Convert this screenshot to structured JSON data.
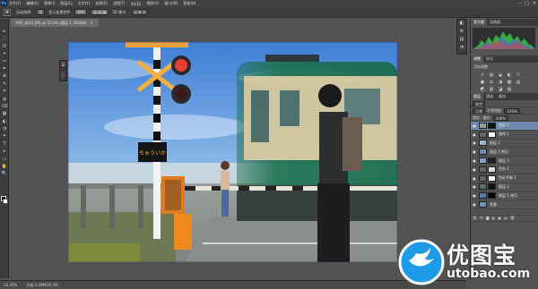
{
  "app": {
    "logo": "Ps",
    "window_controls": [
      "–",
      "□",
      "✕"
    ]
  },
  "menu": [
    "文件(F)",
    "编辑(E)",
    "图像(I)",
    "图层(L)",
    "文字(Y)",
    "选择(S)",
    "滤镜(T)",
    "3D(D)",
    "视图(V)",
    "窗口(W)",
    "帮助(H)"
  ],
  "options": {
    "tool_icon": "move-tool-icon",
    "items": [
      "自动选择:",
      "组",
      "显示变换控件"
    ],
    "align_label": "对齐",
    "mode_label": "3D 模式:"
  },
  "document": {
    "tab_title": "IMG_0021.JPG @ 33.3% (图层 1, RGB/8)",
    "close": "×"
  },
  "collapsed_panel": [
    "☰",
    "ⓘ"
  ],
  "tools": [
    "▸",
    "⬚",
    "ʘ",
    "⌖",
    "✂",
    "✒",
    "⊕",
    "✎",
    "⌗",
    "◍",
    "⌫",
    "▦",
    "◐",
    "◔",
    "✦",
    "T",
    "▸",
    "▭",
    "✋",
    "🔍"
  ],
  "right_strip": [
    "◧",
    "⚙",
    "▤",
    "◔"
  ],
  "histogram_tabs": [
    "直方图",
    "导航器"
  ],
  "adjust_panel": {
    "tabs": [
      "调整",
      "样式"
    ],
    "title": "添加调整",
    "row1": [
      "☼",
      "▥",
      "◒",
      "◐",
      "▽"
    ],
    "row2": [
      "▣",
      "⚖",
      "◑",
      "▦",
      "▤"
    ],
    "row3": [
      "◩",
      "▨",
      "◪",
      "▧"
    ]
  },
  "layers_panel": {
    "tabs": [
      "图层",
      "通道",
      "路径"
    ],
    "kind_label": "类型",
    "blend_mode": "正常",
    "opacity_label": "不透明度:",
    "opacity": "100%",
    "lock_label": "锁定:",
    "fill_label": "填充:",
    "fill": "100%",
    "layers": [
      {
        "name": "图层 4",
        "selected": true,
        "mask": true
      },
      {
        "name": "曲线 1",
        "selected": false,
        "mask": true
      },
      {
        "name": "图层 2",
        "selected": false,
        "mask": false
      },
      {
        "name": "图层 3 拷贝",
        "selected": false,
        "mask": false
      },
      {
        "name": "图层 3",
        "selected": false,
        "mask": true
      },
      {
        "name": "色阶 1",
        "selected": false,
        "mask": true
      },
      {
        "name": "色彩平衡 1",
        "selected": false,
        "mask": true
      },
      {
        "name": "图层 1",
        "selected": false,
        "mask": true
      },
      {
        "name": "图层 1 拷贝",
        "selected": false,
        "mask": true
      },
      {
        "name": "背景",
        "selected": false,
        "mask": false
      }
    ],
    "bottom_icons": [
      "⛓",
      "fx",
      "◙",
      "◐",
      "▣",
      "▤",
      "🗑"
    ]
  },
  "status": {
    "zoom": "33.33%",
    "doc": "文档:5.49M/26.5M"
  },
  "canvas": {
    "sign": "ちゅういか"
  },
  "watermark": {
    "name": "优图宝",
    "url": "utobao.com"
  }
}
